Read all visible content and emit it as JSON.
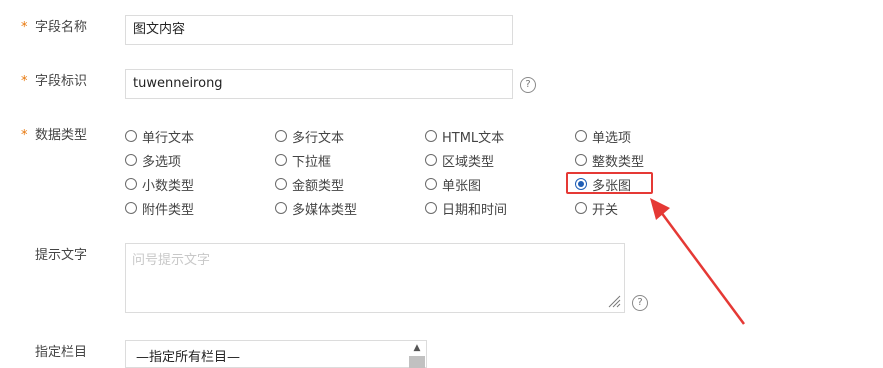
{
  "fields": {
    "name": {
      "required": "*",
      "label": "字段名称",
      "value": "图文内容"
    },
    "identifier": {
      "required": "*",
      "label": "字段标识",
      "value": "tuwenneirong",
      "help": "?"
    },
    "data_type": {
      "required": "*",
      "label": "数据类型",
      "options": [
        "单行文本",
        "多行文本",
        "HTML文本",
        "单选项",
        "多选项",
        "下拉框",
        "区域类型",
        "整数类型",
        "小数类型",
        "金额类型",
        "单张图",
        "多张图",
        "附件类型",
        "多媒体类型",
        "日期和时间",
        "开关"
      ],
      "selected": "多张图"
    },
    "hint": {
      "label": "提示文字",
      "placeholder": "问号提示文字",
      "help": "?"
    },
    "column": {
      "label": "指定栏目",
      "selected": "—指定所有栏目—",
      "scroll_up": "▲"
    }
  },
  "annotation": {
    "highlight_color": "#e53935",
    "arrow_color": "#e53935"
  },
  "colors": {
    "required": "#e8770a",
    "radio_checked": "#1f5eb5"
  }
}
